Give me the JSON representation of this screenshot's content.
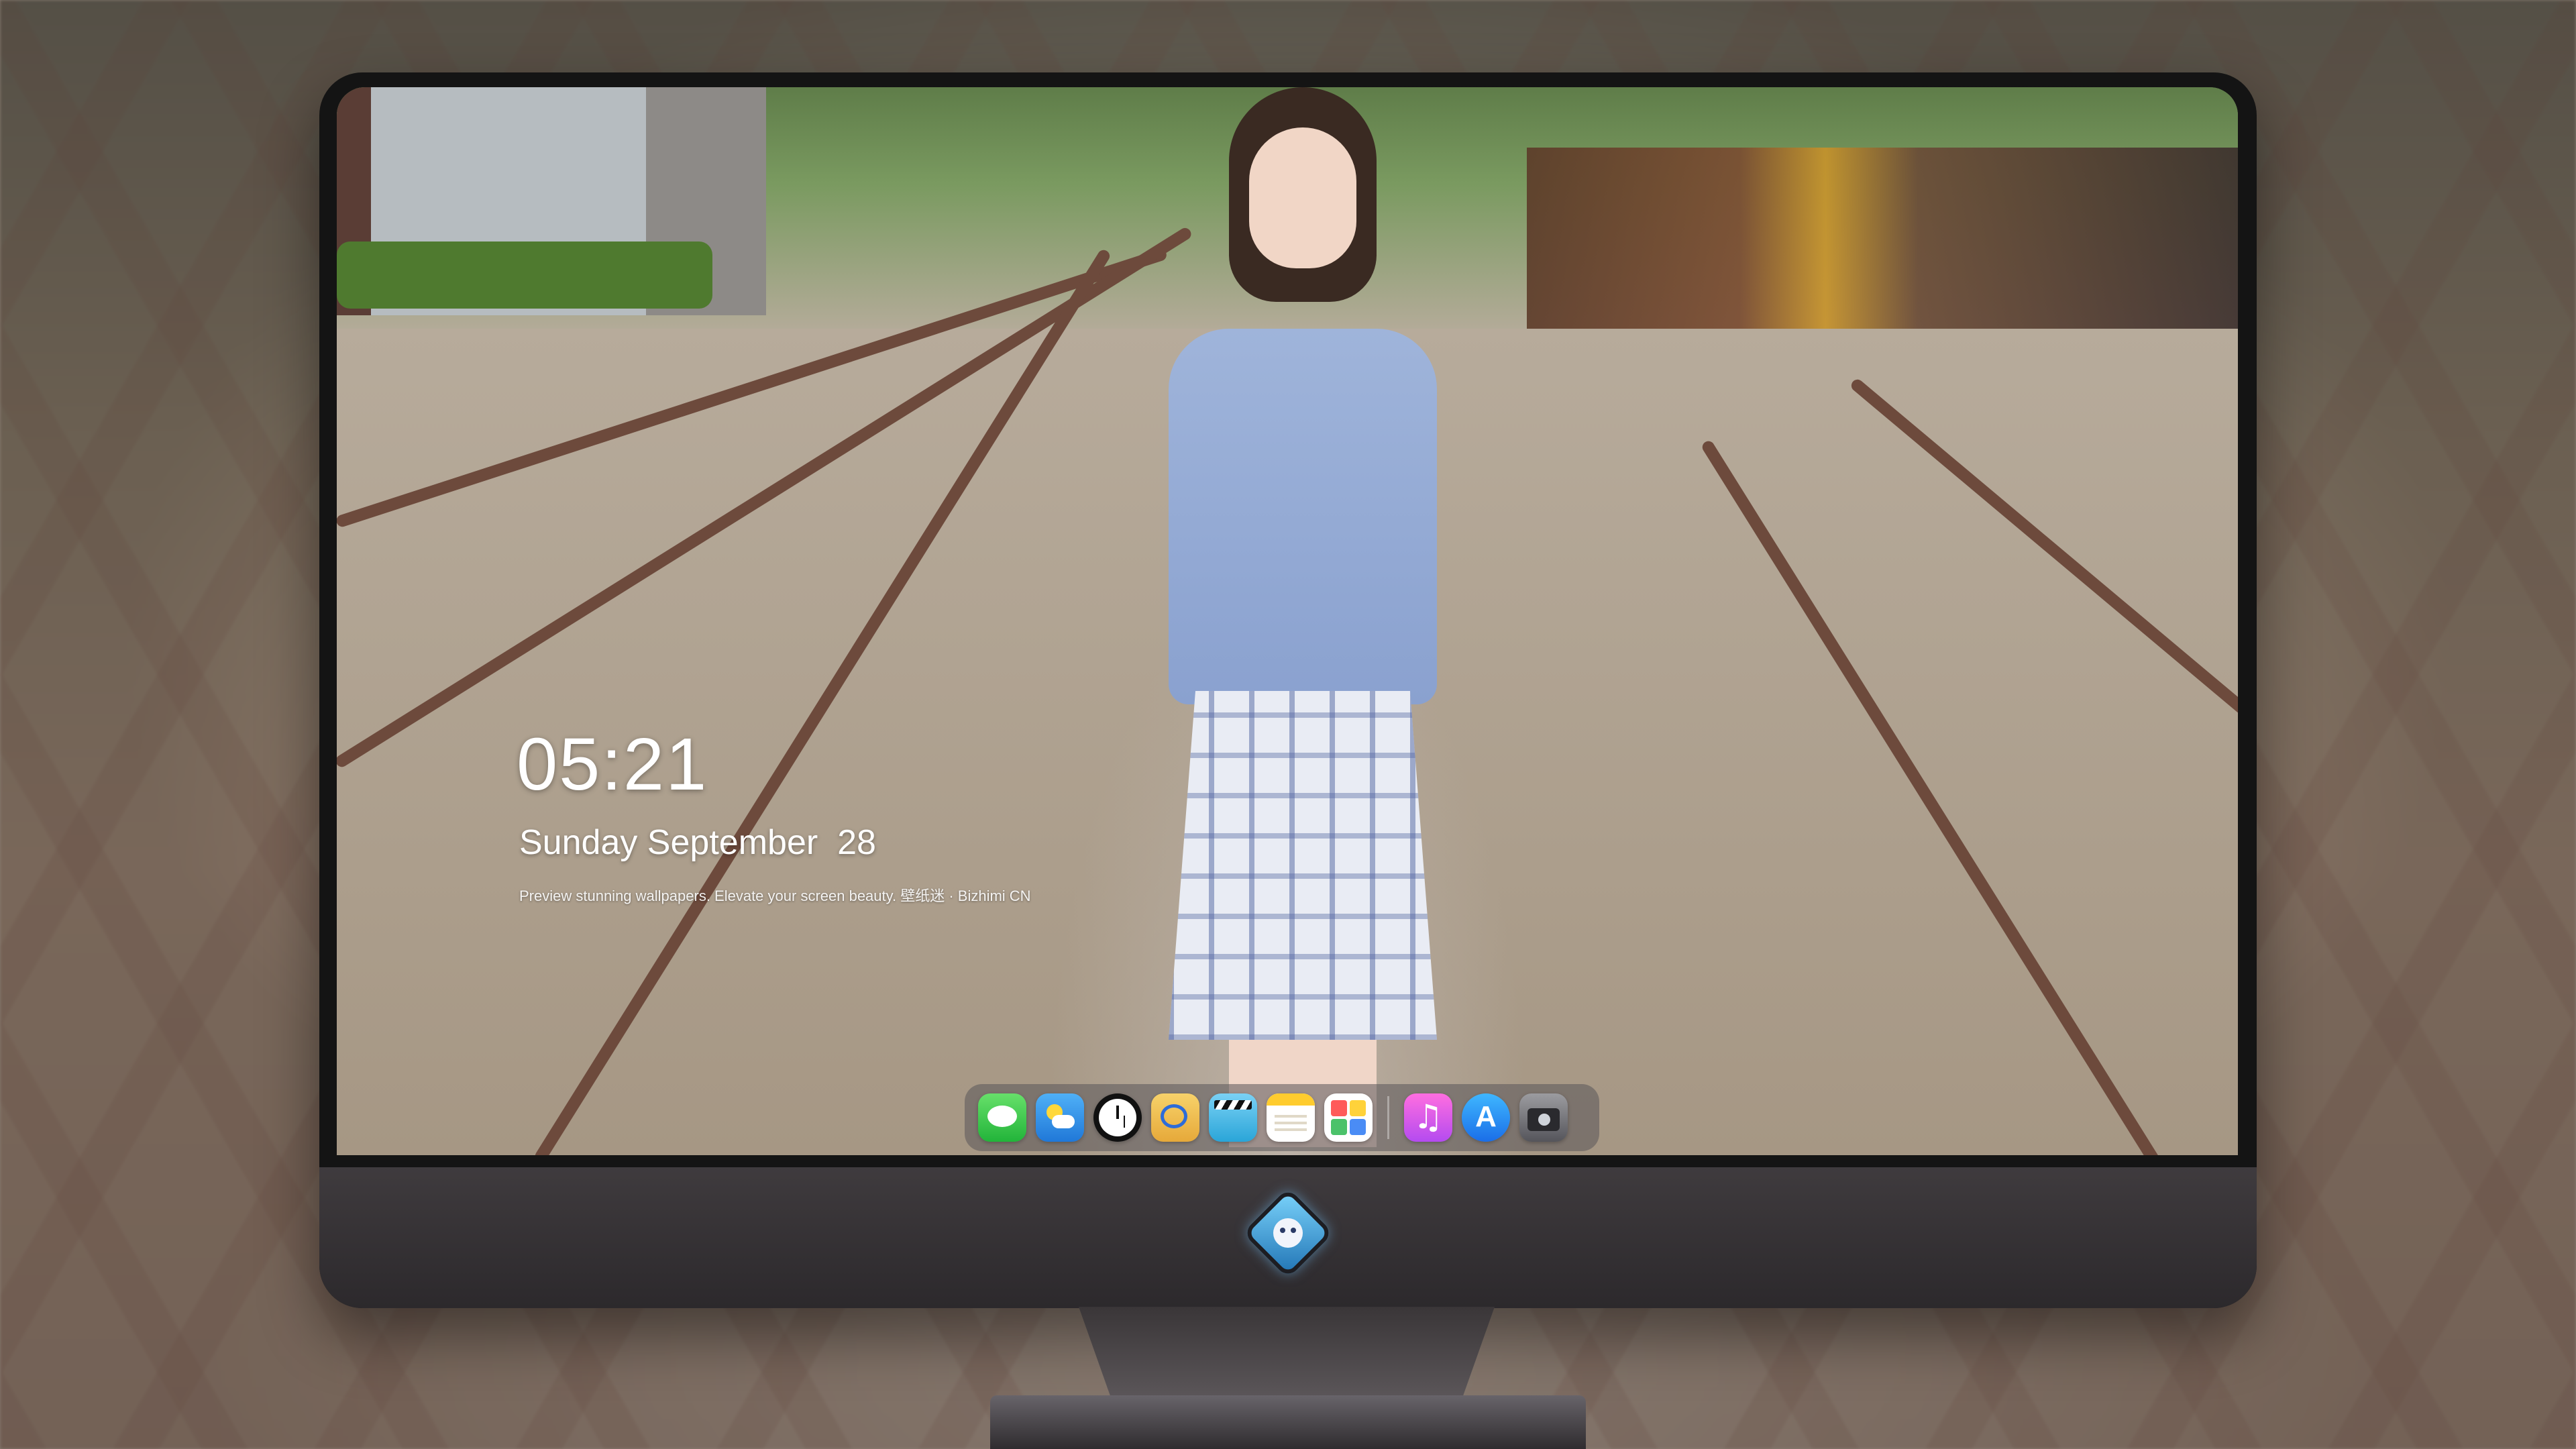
{
  "lock_screen": {
    "time": "05:21",
    "date": "Sunday September  28",
    "tagline": "Preview stunning wallpapers. Elevate your screen beauty. 壁纸迷 · Bizhimi CN"
  },
  "dock": {
    "apps": [
      {
        "name": "Messages",
        "icon": "messages-icon"
      },
      {
        "name": "Weather",
        "icon": "weather-icon"
      },
      {
        "name": "Clock",
        "icon": "clock-icon"
      },
      {
        "name": "Preview",
        "icon": "preview-icon"
      },
      {
        "name": "Clips",
        "icon": "clips-icon"
      },
      {
        "name": "Notes",
        "icon": "notes-icon"
      },
      {
        "name": "Photos",
        "icon": "photos-icon"
      },
      {
        "name": "Music",
        "icon": "music-icon"
      },
      {
        "name": "App Store",
        "icon": "app-store-icon"
      },
      {
        "name": "Camera",
        "icon": "camera-icon"
      }
    ]
  },
  "colors": {
    "monitor_bezel": "#141414",
    "monitor_chin": "#2c292c",
    "dock_background": "#5a555a",
    "text": "#ffffff"
  }
}
